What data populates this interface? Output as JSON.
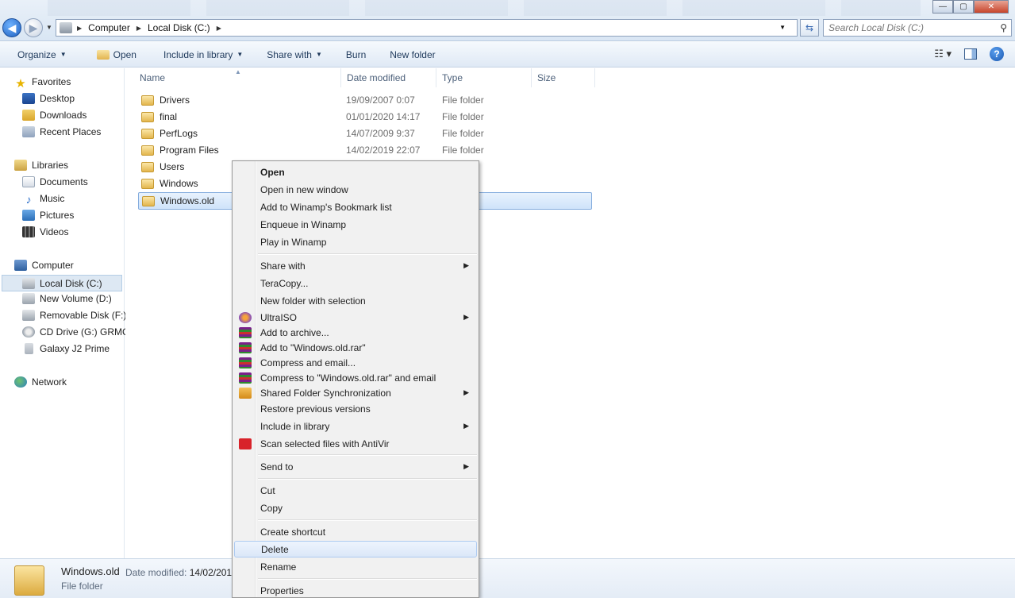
{
  "window": {
    "minimize_label": "—",
    "maximize_label": "▢",
    "close_label": "✕"
  },
  "address_bar": {
    "crumbs": [
      "Computer",
      "Local Disk (C:)"
    ],
    "search_placeholder": "Search Local Disk (C:)"
  },
  "toolbar": {
    "organize": "Organize",
    "open": "Open",
    "include_in_library": "Include in library",
    "share_with": "Share with",
    "burn": "Burn",
    "new_folder": "New folder"
  },
  "nav": {
    "favorites": "Favorites",
    "desktop": "Desktop",
    "downloads": "Downloads",
    "recent_places": "Recent Places",
    "libraries": "Libraries",
    "documents": "Documents",
    "music": "Music",
    "pictures": "Pictures",
    "videos": "Videos",
    "computer": "Computer",
    "local_disk": "Local Disk (C:)",
    "new_volume": "New Volume (D:)",
    "removable_disk": "Removable Disk (F:)",
    "cd_drive": "CD Drive (G:) GRMC",
    "galaxy": "Galaxy J2 Prime",
    "network": "Network"
  },
  "columns": {
    "name": "Name",
    "date_modified": "Date modified",
    "type": "Type",
    "size": "Size"
  },
  "files": [
    {
      "name": "Drivers",
      "date": "19/09/2007 0:07",
      "type": "File folder"
    },
    {
      "name": "final",
      "date": "01/01/2020 14:17",
      "type": "File folder"
    },
    {
      "name": "PerfLogs",
      "date": "14/07/2009 9:37",
      "type": "File folder"
    },
    {
      "name": "Program Files",
      "date": "14/02/2019 22:07",
      "type": "File folder"
    },
    {
      "name": "Users",
      "date": "",
      "type": ""
    },
    {
      "name": "Windows",
      "date": "",
      "type": ""
    },
    {
      "name": "Windows.old",
      "date": "",
      "type": ""
    }
  ],
  "context_menu": {
    "open": "Open",
    "open_new_window": "Open in new window",
    "winamp_bookmark": "Add to Winamp's Bookmark list",
    "enqueue_winamp": "Enqueue in Winamp",
    "play_winamp": "Play in Winamp",
    "share_with": "Share with",
    "teracopy": "TeraCopy...",
    "new_folder_selection": "New folder with selection",
    "ultraiso": "UltraISO",
    "add_archive": "Add to archive...",
    "add_rar": "Add to \"Windows.old.rar\"",
    "compress_email": "Compress and email...",
    "compress_rar_email": "Compress to \"Windows.old.rar\" and email",
    "shared_sync": "Shared Folder Synchronization",
    "restore_versions": "Restore previous versions",
    "include_library": "Include in library",
    "scan_antivir": "Scan selected files with AntiVir",
    "send_to": "Send to",
    "cut": "Cut",
    "copy": "Copy",
    "create_shortcut": "Create shortcut",
    "delete": "Delete",
    "rename": "Rename",
    "properties": "Properties"
  },
  "details": {
    "name": "Windows.old",
    "date_label": "Date modified:",
    "date_value": "14/02/201",
    "type": "File folder"
  }
}
